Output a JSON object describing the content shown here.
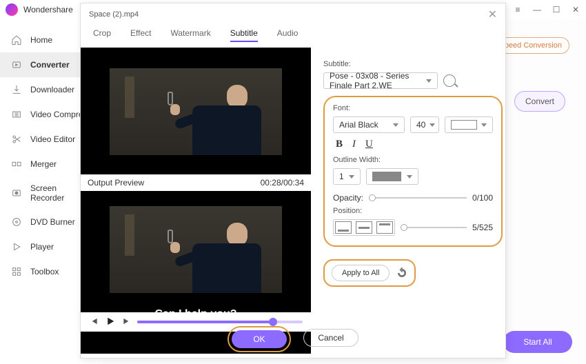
{
  "titlebar": {
    "appname": "Wondershare"
  },
  "sidebar": {
    "items": [
      {
        "label": "Home"
      },
      {
        "label": "Converter"
      },
      {
        "label": "Downloader"
      },
      {
        "label": "Video Compress"
      },
      {
        "label": "Video Editor"
      },
      {
        "label": "Merger"
      },
      {
        "label": "Screen Recorder"
      },
      {
        "label": "DVD Burner"
      },
      {
        "label": "Player"
      },
      {
        "label": "Toolbox"
      }
    ]
  },
  "main": {
    "speed_label": "Speed Conversion",
    "convert": "Convert",
    "start_all": "Start All"
  },
  "modal": {
    "filename": "Space (2).mp4",
    "tabs": {
      "crop": "Crop",
      "effect": "Effect",
      "watermark": "Watermark",
      "subtitle": "Subtitle",
      "audio": "Audio"
    },
    "preview_label": "Output Preview",
    "timecode": "00:28/00:34",
    "subtitle_text": "Can I help you?"
  },
  "panel": {
    "subtitle_label": "Subtitle:",
    "subtitle_value": "Pose - 03x08 - Series Finale Part 2.WE",
    "font_label": "Font:",
    "font_family": "Arial Black",
    "font_size": "40",
    "outline_label": "Outline Width:",
    "outline_value": "1",
    "opacity_label": "Opacity:",
    "opacity_value": "0/100",
    "position_label": "Position:",
    "position_value": "5/525",
    "apply": "Apply to All",
    "ok": "OK",
    "cancel": "Cancel"
  }
}
